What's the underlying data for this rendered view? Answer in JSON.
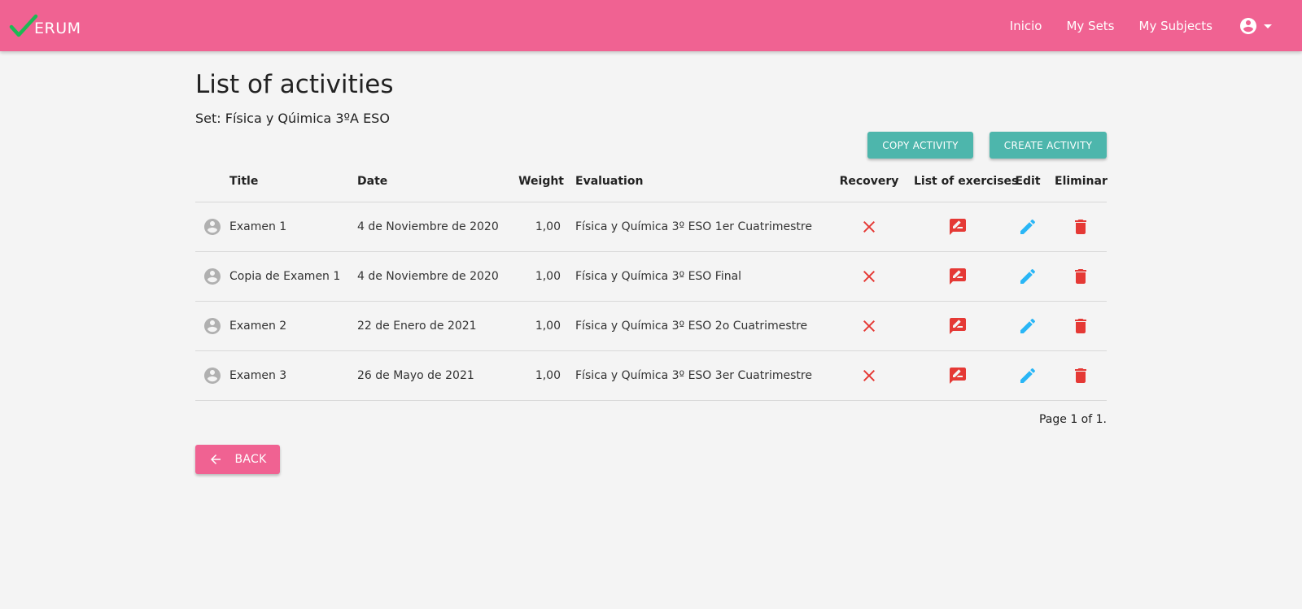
{
  "brand": {
    "name": "ERUM"
  },
  "nav": {
    "links": [
      {
        "label": "Inicio"
      },
      {
        "label": "My Sets"
      },
      {
        "label": "My Subjects"
      }
    ]
  },
  "page": {
    "title": "List of activities",
    "set_line": "Set: Física y Qúimica 3ºA ESO"
  },
  "actions": {
    "copy_label": "COPY ACTIVITY",
    "create_label": "CREATE ACTIVITY",
    "back_label": "BACK"
  },
  "table": {
    "headers": {
      "title": "Title",
      "date": "Date",
      "weight": "Weight",
      "evaluation": "Evaluation",
      "recovery": "Recovery",
      "exercises": "List of exercises",
      "edit": "Edit",
      "delete": "Eliminar"
    },
    "rows": [
      {
        "title": "Examen 1",
        "date": "4 de Noviembre de 2020",
        "weight": "1,00",
        "evaluation": "Física y Química 3º ESO 1er Cuatrimestre"
      },
      {
        "title": "Copia de Examen 1",
        "date": "4 de Noviembre de 2020",
        "weight": "1,00",
        "evaluation": "Física y Química 3º ESO Final"
      },
      {
        "title": "Examen 2",
        "date": "22 de Enero de 2021",
        "weight": "1,00",
        "evaluation": "Física y Química 3º ESO 2o Cuatrimestre"
      },
      {
        "title": "Examen 3",
        "date": "26 de Mayo de 2021",
        "weight": "1,00",
        "evaluation": "Física y Química 3º ESO 3er Cuatrimestre"
      }
    ]
  },
  "pagination": {
    "text": "Page 1 of 1."
  },
  "colors": {
    "navbar": "#f06292",
    "teal_button": "#4db6ac",
    "logo_check": "#1db954",
    "recovery_x": "#e53935",
    "exercises_icon": "#e53935",
    "edit_icon": "#29b6f6",
    "delete_icon": "#e53935",
    "row_avatar": "#b0b0b0"
  },
  "icons": {
    "logo": "checkmark-icon",
    "account": "account-circle-icon",
    "account_menu": "caret-down-icon",
    "row_avatar": "account-circle-icon",
    "recovery": "close-icon",
    "exercises": "rate-review-icon",
    "edit": "pencil-icon",
    "delete": "trash-icon",
    "back": "arrow-left-icon"
  }
}
